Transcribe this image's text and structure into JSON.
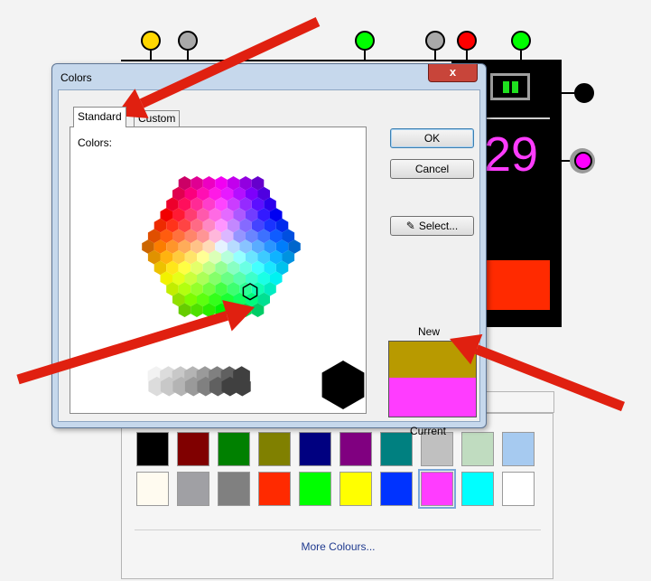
{
  "background_dots": [
    {
      "color": "#ffd700"
    },
    {
      "color": "#a9a9a9"
    },
    {
      "color": "#00ff00"
    },
    {
      "color": "#a9a9a9"
    },
    {
      "color": "#ff0000"
    },
    {
      "color": "#00ff00"
    },
    {
      "color": "#000000"
    },
    {
      "color": "#ff00ff"
    }
  ],
  "background_panel": {
    "number": "29",
    "indicator_color": "#1fe01f",
    "red_box_color": "#ff2a00"
  },
  "dialog": {
    "title": "Colors",
    "close_label": "x",
    "tabs": [
      {
        "label": "Standard",
        "active": true
      },
      {
        "label": "Custom",
        "active": false
      }
    ],
    "colors_label": "Colors:",
    "buttons": {
      "ok": "OK",
      "cancel": "Cancel",
      "select": "Select..."
    },
    "new_label": "New",
    "current_label": "Current",
    "new_color": "#b89a00",
    "current_color": "#ff3cff"
  },
  "palette": {
    "row1": [
      "#000000",
      "#800000",
      "#008000",
      "#808000",
      "#000080",
      "#800080",
      "#008080",
      "#c0c0c0",
      "#c0dcc0",
      "#a6caf0"
    ],
    "row2": [
      "#fffbf0",
      "#a0a0a4",
      "#808080",
      "#ff2a00",
      "#00ff00",
      "#ffff00",
      "#0033ff",
      "#ff3cff",
      "#00ffff",
      "#ffffff"
    ],
    "selected_index_row2": 7,
    "more_label": "More Colours..."
  },
  "annotation_color": "#e02010"
}
